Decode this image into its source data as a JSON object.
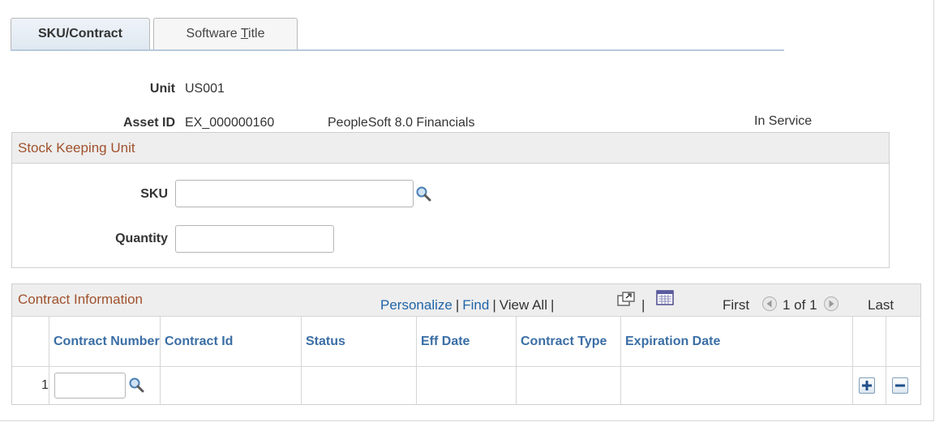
{
  "tabs": [
    {
      "label": "SKU/Contract",
      "active": true
    },
    {
      "label": "Software ",
      "underline_char": "T",
      "rest": "itle",
      "active": false
    }
  ],
  "unit": {
    "label": "Unit",
    "value": "US001"
  },
  "asset": {
    "label": "Asset ID",
    "id": "EX_000000160",
    "description": "PeopleSoft 8.0 Financials",
    "status": "In Service"
  },
  "sku_group": {
    "title": "Stock Keeping Unit",
    "sku_label": "SKU",
    "sku_value": "",
    "quantity_label": "Quantity",
    "quantity_value": ""
  },
  "contract_grid": {
    "title": "Contract Information",
    "toolbar": {
      "personalize": "Personalize",
      "find": "Find",
      "view_all": "View All",
      "sep": "|"
    },
    "pager": {
      "first": "First",
      "range": "1 of 1",
      "last": "Last"
    },
    "columns": [
      "Contract Number",
      "Contract Id",
      "Status",
      "Eff Date",
      "Contract Type",
      "Expiration Date"
    ],
    "rows": [
      {
        "num": "1",
        "contract_number": "",
        "contract_id": "",
        "status": "",
        "eff_date": "",
        "contract_type": "",
        "expiration_date": ""
      }
    ]
  },
  "colors": {
    "group_title": "#a0522d",
    "link": "#1f64a8",
    "column_header": "#3a6ea5"
  }
}
